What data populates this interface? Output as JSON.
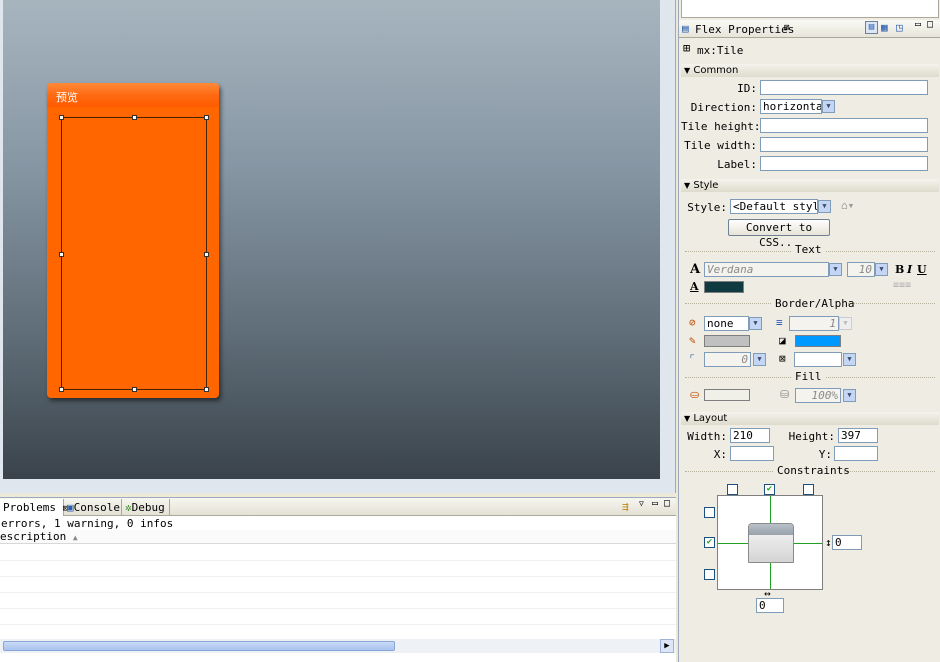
{
  "canvas": {
    "panel_title": "预览"
  },
  "problems": {
    "tabs": [
      {
        "label": "Problems",
        "icon": "problems-icon",
        "close": "⊠"
      },
      {
        "label": "Console",
        "icon": "console-icon"
      },
      {
        "label": "Debug",
        "icon": "debug-icon"
      }
    ],
    "summary": "errors, 1 warning, 0 infos",
    "column_description": "escription"
  },
  "properties": {
    "tab_label": "Flex Properties",
    "component": "mx:Tile",
    "common": {
      "section": "Common",
      "id_label": "ID:",
      "id_value": "",
      "direction_label": "Direction:",
      "direction_value": "horizontal",
      "tile_height_label": "Tile height:",
      "tile_height_value": "",
      "tile_width_label": "Tile width:",
      "tile_width_value": "",
      "label_label": "Label:",
      "label_value": ""
    },
    "style": {
      "section": "Style",
      "style_label": "Style:",
      "style_value": "<Default style>",
      "convert_button": "Convert to CSS...",
      "text_title": "Text",
      "font_value": "Verdana",
      "font_size_value": "10",
      "bold": "B",
      "italic": "I",
      "underline": "U",
      "text_color": "#0f3a40",
      "border_alpha_title": "Border/Alpha",
      "border_style_value": "none",
      "border_thickness_value": "1",
      "border_color": "#c0c0c0",
      "background_color": "#0099ff",
      "corner_radius_value": "0",
      "fill_title": "Fill",
      "fill_alpha_value": "100%"
    },
    "layout": {
      "section": "Layout",
      "width_label": "Width:",
      "width_value": "210",
      "height_label": "Height:",
      "height_value": "397",
      "x_label": "X:",
      "x_value": "",
      "y_label": "Y:",
      "y_value": "",
      "constraints_title": "Constraints",
      "right_value": "0",
      "bottom_value": "0"
    }
  },
  "colors": {
    "panel_orange": "#ff6600",
    "canvas_top": "#a7b5bf",
    "canvas_bottom": "#3a434b",
    "check_green": "#21a121"
  }
}
